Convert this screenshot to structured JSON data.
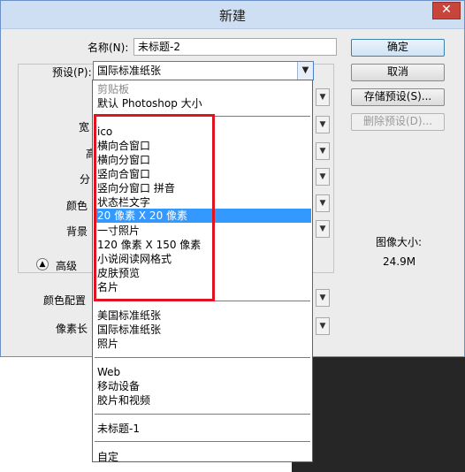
{
  "window": {
    "title": "新建",
    "close_glyph": "✕"
  },
  "form": {
    "name_label": "名称(N):",
    "name_value": "未标题-2",
    "preset_label": "预设(P):",
    "preset_value": "国际标准纸张",
    "hidden_labels": [
      "宽",
      "高",
      "分",
      "颜色",
      "背景"
    ],
    "advanced_label": "高级",
    "color_profile_label": "颜色配置",
    "pixel_ratio_label": "像素长"
  },
  "buttons": {
    "ok": "确定",
    "cancel": "取消",
    "save_preset": "存储预设(S)...",
    "delete_preset": "删除预设(D)..."
  },
  "image_size": {
    "label": "图像大小:",
    "value": "24.9M"
  },
  "dropdown": {
    "group1": [
      "剪贴板",
      "默认 Photoshop 大小"
    ],
    "group2": [
      "ico",
      "横向合窗口",
      "横向分窗口",
      "竖向合窗口",
      "竖向分窗口 拼音",
      "状态栏文字",
      "20 像素 X 20 像素",
      "一寸照片",
      "120 像素 X 150 像素",
      "小说阅读网格式",
      "皮肤预览",
      "名片"
    ],
    "group3": [
      "美国标准纸张",
      "国际标准纸张",
      "照片"
    ],
    "group4": [
      "Web",
      "移动设备",
      "胶片和视频"
    ],
    "group5": [
      "未标题-1"
    ],
    "group6": [
      "自定"
    ],
    "selected_item": "20 像素 X 20 像素"
  },
  "icons": {
    "combo_arrow": "chevron-down-icon",
    "advanced": "chevron-up-circle-icon"
  },
  "colors": {
    "highlight": "#3399ff",
    "annotation": "#e0141e",
    "titlebar": "#cfdff3"
  }
}
